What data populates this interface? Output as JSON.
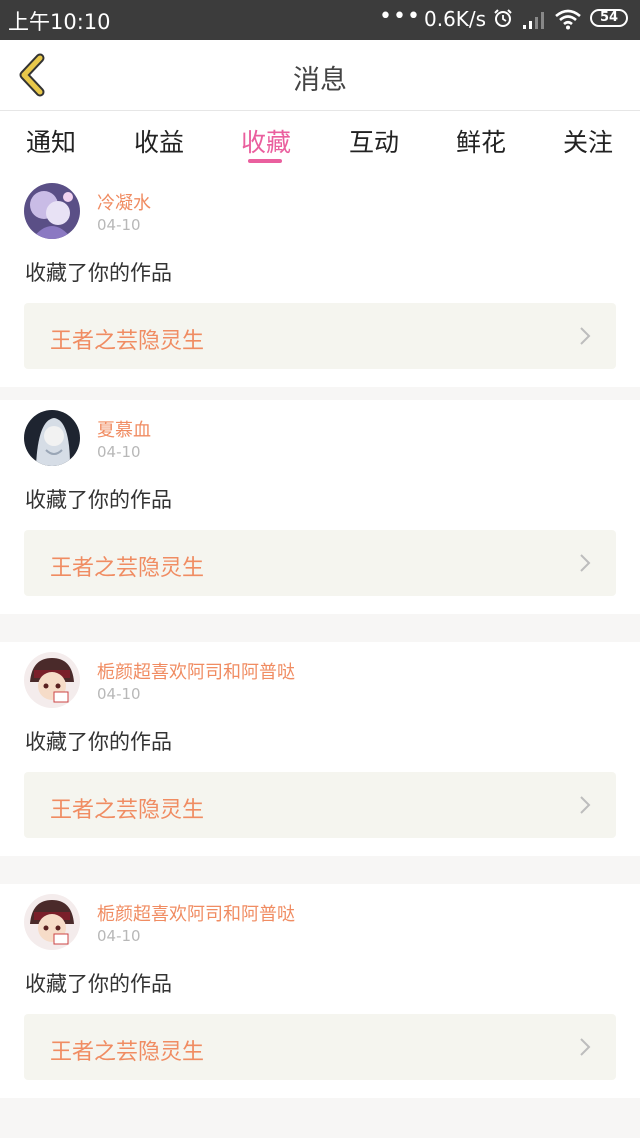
{
  "status_bar": {
    "time": "上午10:10",
    "dots": "•••",
    "speed": "0.6K/s",
    "battery": "54"
  },
  "header": {
    "title": "消息"
  },
  "tabs": [
    {
      "label": "通知",
      "active": false
    },
    {
      "label": "收益",
      "active": false
    },
    {
      "label": "收藏",
      "active": true
    },
    {
      "label": "互动",
      "active": false
    },
    {
      "label": "鲜花",
      "active": false
    },
    {
      "label": "关注",
      "active": false
    }
  ],
  "messages": [
    {
      "user": "冷凝水",
      "date": "04-10",
      "action": "收藏了你的作品",
      "work": "王者之芸隐灵生"
    },
    {
      "user": "夏慕血",
      "date": "04-10",
      "action": "收藏了你的作品",
      "work": "王者之芸隐灵生"
    },
    {
      "user": "栀颜超喜欢阿司和阿普哒",
      "date": "04-10",
      "action": "收藏了你的作品",
      "work": "王者之芸隐灵生"
    },
    {
      "user": "栀颜超喜欢阿司和阿普哒",
      "date": "04-10",
      "action": "收藏了你的作品",
      "work": "王者之芸隐灵生"
    }
  ],
  "colors": {
    "accent": "#ea5f9e",
    "username": "#f08c62",
    "back_arrow": "#e8c84a"
  }
}
